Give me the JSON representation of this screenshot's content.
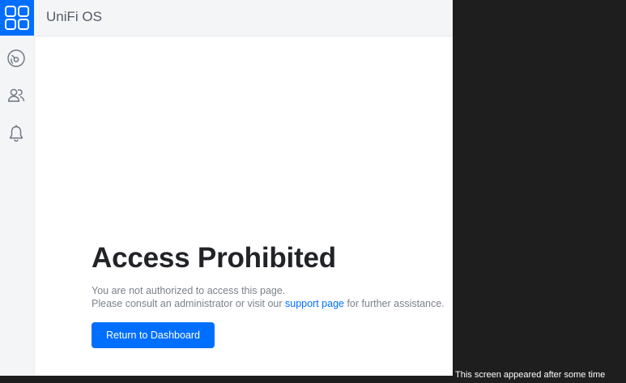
{
  "app": {
    "title": "UniFi OS"
  },
  "sidebar": {
    "items": [
      {
        "icon": "dashboard-gauge-icon"
      },
      {
        "icon": "users-icon"
      },
      {
        "icon": "bell-icon"
      }
    ]
  },
  "page": {
    "heading": "Access Prohibited",
    "line1": "You are not authorized to access this page.",
    "line2_prefix": "Please consult an administrator or visit our ",
    "support_link": "support page",
    "line2_suffix": " for further assistance.",
    "button_label": "Return to Dashboard"
  },
  "overlay_caption": "This screen appeared after some time",
  "colors": {
    "accent": "#006fff",
    "background_dark": "#1e1e1e",
    "sidebar_bg": "#f4f5f7"
  }
}
